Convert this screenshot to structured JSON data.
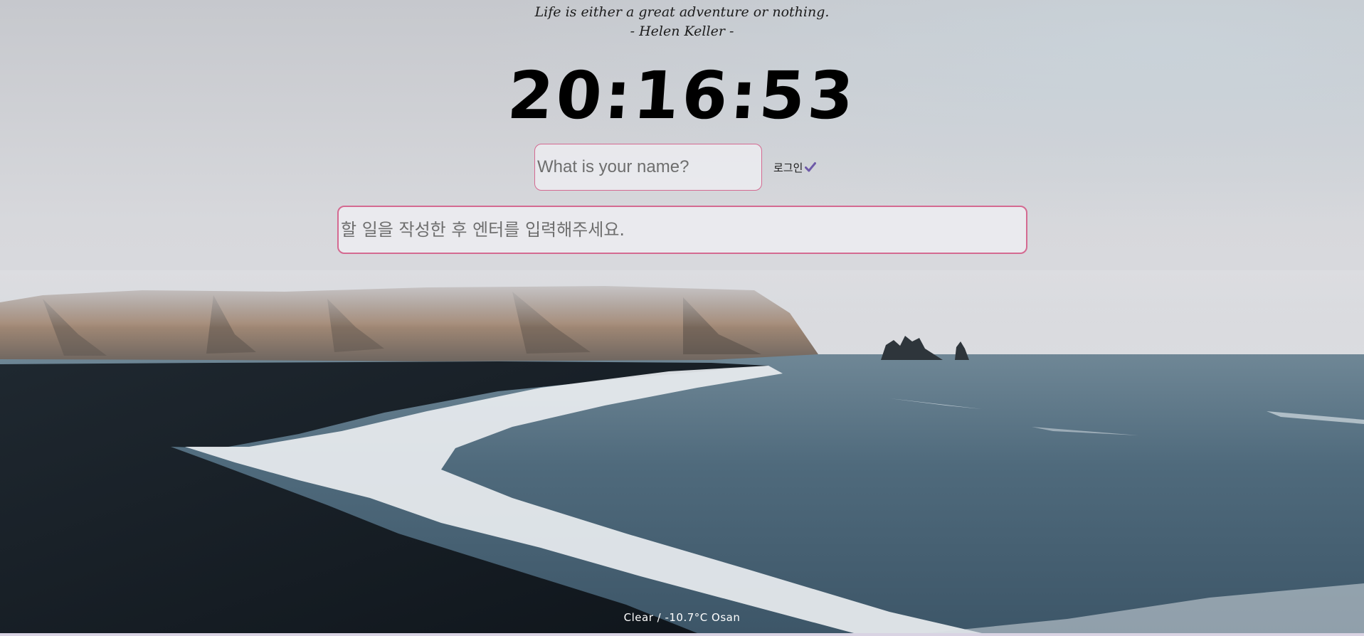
{
  "quote": {
    "text": "Life is either a great adventure or nothing.",
    "author": "- Helen Keller -"
  },
  "clock": {
    "time": "20:16:53"
  },
  "login": {
    "name_placeholder": "What is your name?",
    "name_value": "",
    "button_label": "로그인",
    "icon": "check-icon",
    "icon_color": "#6e5aa8"
  },
  "todo": {
    "placeholder": "할 일을 작성한 후 엔터를 입력해주세요.",
    "value": ""
  },
  "weather": {
    "text": "Clear / -10.7°C Osan"
  },
  "theme": {
    "input_border": "#d46a91"
  }
}
